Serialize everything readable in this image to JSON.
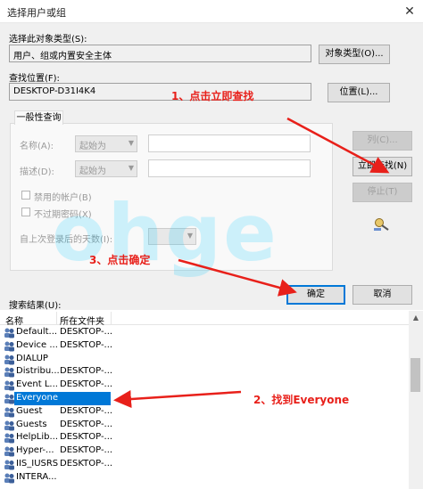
{
  "window": {
    "title": "选择用户或组",
    "close_glyph": "✕"
  },
  "object_type": {
    "label": "选择此对象类型(S):",
    "value": "用户、组或内置安全主体",
    "button": "对象类型(O)..."
  },
  "location": {
    "label": "查找位置(F):",
    "value": "DESKTOP-D31I4K4",
    "button": "位置(L)..."
  },
  "common_query": {
    "tab": "一般性查询",
    "name_label": "名称(A):",
    "desc_label": "描述(D):",
    "starts_with_1": "起始为",
    "starts_with_2": "起始为",
    "disabled_accounts": "禁用的帐户(B)",
    "no_expire_pwd": "不过期密码(X)",
    "days_since_login": "自上次登录后的天数(I):"
  },
  "side_buttons": {
    "columns": "列(C)...",
    "find_now": "立即查找(N)",
    "stop": "停止(T)"
  },
  "actions": {
    "ok": "确定",
    "cancel": "取消"
  },
  "results": {
    "label": "搜索结果(U):",
    "col_name": "名称",
    "col_folder": "所在文件夹",
    "rows": [
      {
        "name": "Default...",
        "folder": "DESKTOP-..."
      },
      {
        "name": "Device ...",
        "folder": "DESKTOP-..."
      },
      {
        "name": "DIALUP",
        "folder": ""
      },
      {
        "name": "Distribu...",
        "folder": "DESKTOP-..."
      },
      {
        "name": "Event L...",
        "folder": "DESKTOP-..."
      },
      {
        "name": "Everyone",
        "folder": ""
      },
      {
        "name": "Guest",
        "folder": "DESKTOP-..."
      },
      {
        "name": "Guests",
        "folder": "DESKTOP-..."
      },
      {
        "name": "HelpLib...",
        "folder": "DESKTOP-..."
      },
      {
        "name": "Hyper-...",
        "folder": "DESKTOP-..."
      },
      {
        "name": "IIS_IUSRS",
        "folder": "DESKTOP-..."
      },
      {
        "name": "INTERA...",
        "folder": ""
      }
    ]
  },
  "annotations": {
    "step1": "1、点击立即查找",
    "step2": "2、找到Everyone",
    "step3": "3、点击确定"
  },
  "watermark": "ohge",
  "colors": {
    "accent": "#0078d7",
    "annotation": "#e8201a"
  }
}
